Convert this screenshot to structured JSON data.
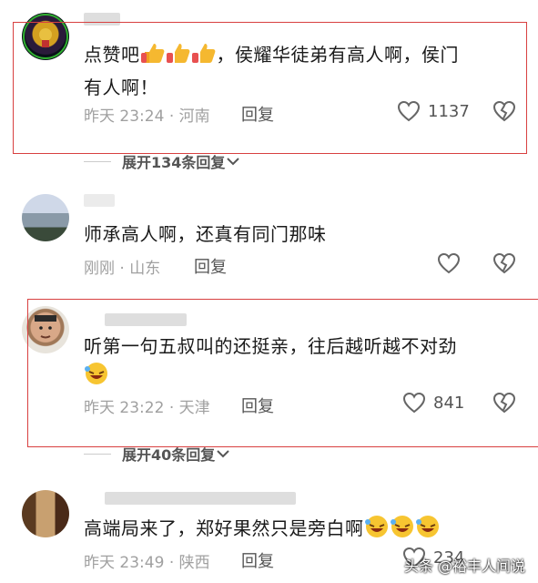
{
  "comments": [
    {
      "text_line1": "点赞吧",
      "text_line1_after": "，侯耀华徒弟有高人啊，侯门",
      "text_line2": "有人啊！",
      "time": "昨天 23:24",
      "sep": "·",
      "location": "河南",
      "reply_label": "回复",
      "like_count": "1137"
    },
    {
      "text": "师承高人啊，还真有同门那味",
      "time": "刚刚",
      "sep": "·",
      "location": "山东",
      "reply_label": "回复",
      "like_count": ""
    },
    {
      "text": "听第一句五叔叫的还挺亲，往后越听越不对劲",
      "time": "昨天 23:22",
      "sep": "·",
      "location": "天津",
      "reply_label": "回复",
      "like_count": "841"
    },
    {
      "text": "高端局来了，郑好果然只是旁白啊",
      "time": "昨天 23:49",
      "sep": "·",
      "location": "陕西",
      "reply_label": "回复",
      "like_count": "234"
    }
  ],
  "expand_replies": [
    {
      "label": "展开134条回复"
    },
    {
      "label": "展开40条回复"
    }
  ],
  "watermark": "头条 @裕丰人间说",
  "icons": {
    "like": "heart-outline-icon",
    "dislike": "broken-heart-icon",
    "expand": "chevron-down-icon",
    "thumbs": "thumbs-up-emoji",
    "laugh": "laughing-emoji"
  },
  "colors": {
    "highlight": "#d84040",
    "meta": "#a0a0a0",
    "text": "#1a1a1a"
  }
}
